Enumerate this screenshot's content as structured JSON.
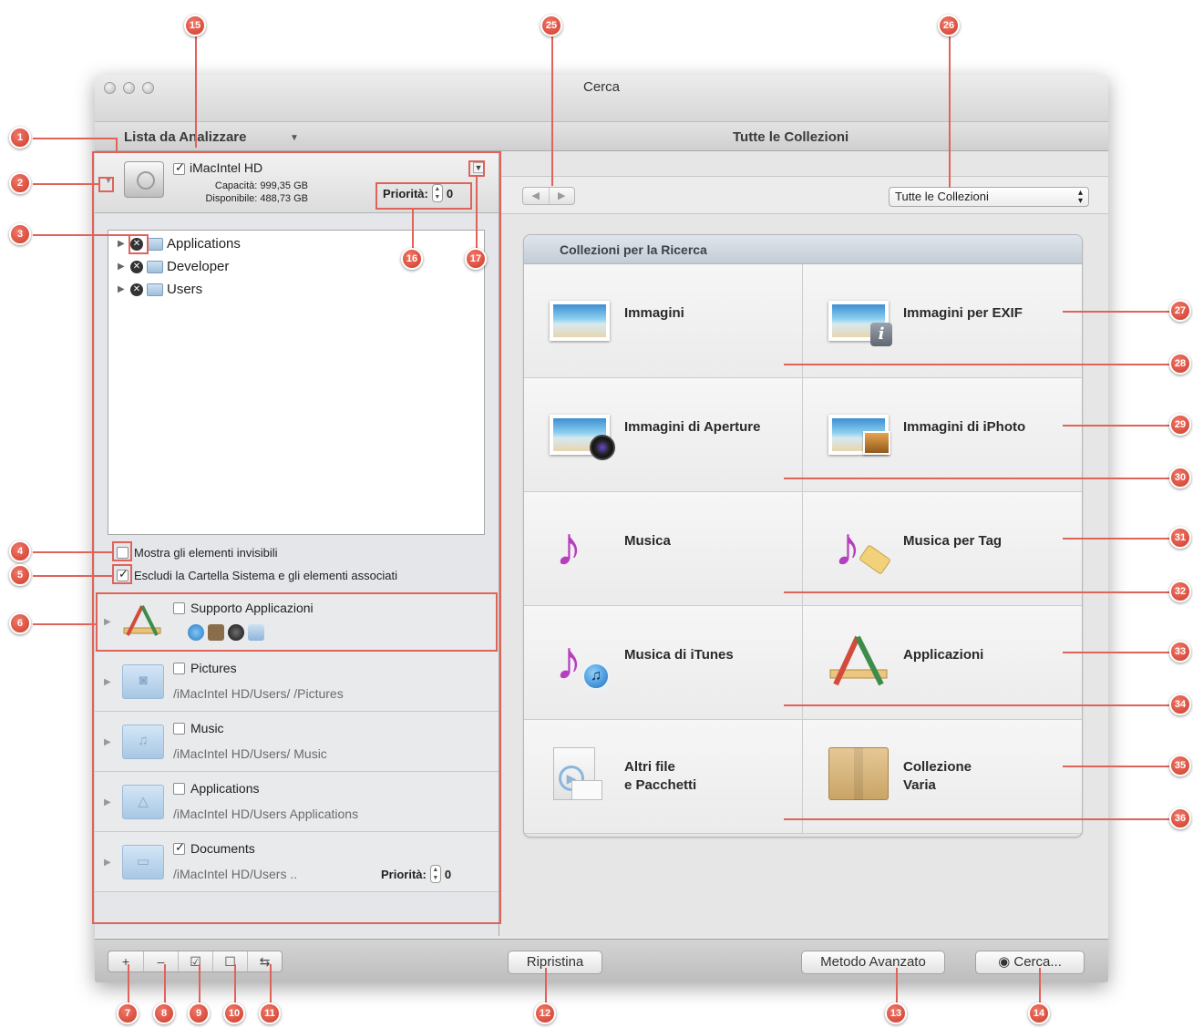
{
  "window": {
    "title": "Cerca"
  },
  "header": {
    "left_title": "Lista da Analizzare",
    "left_arrow": "▼",
    "right_title": "Tutte le Collezioni"
  },
  "drive": {
    "name": "iMacIntel HD",
    "capacity": "Capacità: 999,35 GB",
    "available": "Disponibile: 488,73 GB",
    "priority_label": "Priorità:",
    "priority_value": "0"
  },
  "tree": {
    "items": [
      {
        "label": "Applications"
      },
      {
        "label": "Developer"
      },
      {
        "label": "Users"
      }
    ]
  },
  "options": {
    "show_invisible": "Mostra gli elementi invisibili",
    "exclude_system": "Escludi la Cartella Sistema e gli elementi associati"
  },
  "locations": [
    {
      "name": "Supporto Applicazioni",
      "path": "",
      "checked": false
    },
    {
      "name": "Pictures",
      "path": "/iMacIntel HD/Users/          /Pictures",
      "checked": false
    },
    {
      "name": "Music",
      "path": "/iMacIntel HD/Users/          Music",
      "checked": false
    },
    {
      "name": "Applications",
      "path": "/iMacIntel HD/Users          Applications",
      "checked": false
    },
    {
      "name": "Documents",
      "path": "/iMacIntel HD/Users            ..",
      "checked": true,
      "priority_label": "Priorità:",
      "priority_value": "0"
    }
  ],
  "collections_select": {
    "value": "Tutte le Collezioni"
  },
  "panel": {
    "title": "Collezioni per la Ricerca",
    "cells": [
      {
        "label": "Immagini",
        "icon": "photo-icon"
      },
      {
        "label": "Immagini per EXIF",
        "icon": "photo-exif-icon"
      },
      {
        "label": "Immagini di Aperture",
        "icon": "aperture-photo-icon"
      },
      {
        "label": "Immagini di iPhoto",
        "icon": "iphoto-photo-icon"
      },
      {
        "label": "Musica",
        "icon": "music-note-icon"
      },
      {
        "label": "Musica per Tag",
        "icon": "music-tag-icon"
      },
      {
        "label": "Musica di iTunes",
        "icon": "itunes-music-icon"
      },
      {
        "label": "Applicazioni",
        "icon": "applications-icon"
      },
      {
        "label_line1": "Altri file",
        "label_line2": "e Pacchetti",
        "icon": "other-files-icon"
      },
      {
        "label_line1": "Collezione",
        "label_line2": "Varia",
        "icon": "box-icon"
      }
    ]
  },
  "bottom": {
    "seg": [
      "+",
      "–",
      "☑",
      "☐",
      "⇆"
    ],
    "reset": "Ripristina",
    "advanced": "Metodo Avanzato",
    "search": "Cerca..."
  },
  "callouts": [
    "1",
    "2",
    "3",
    "4",
    "5",
    "6",
    "7",
    "8",
    "9",
    "10",
    "11",
    "12",
    "13",
    "14",
    "15",
    "16",
    "17",
    "25",
    "26",
    "27",
    "28",
    "29",
    "30",
    "31",
    "32",
    "33",
    "34",
    "35",
    "36"
  ],
  "colors": {
    "annotation": "#e0635a",
    "music": "#b63fbf"
  }
}
